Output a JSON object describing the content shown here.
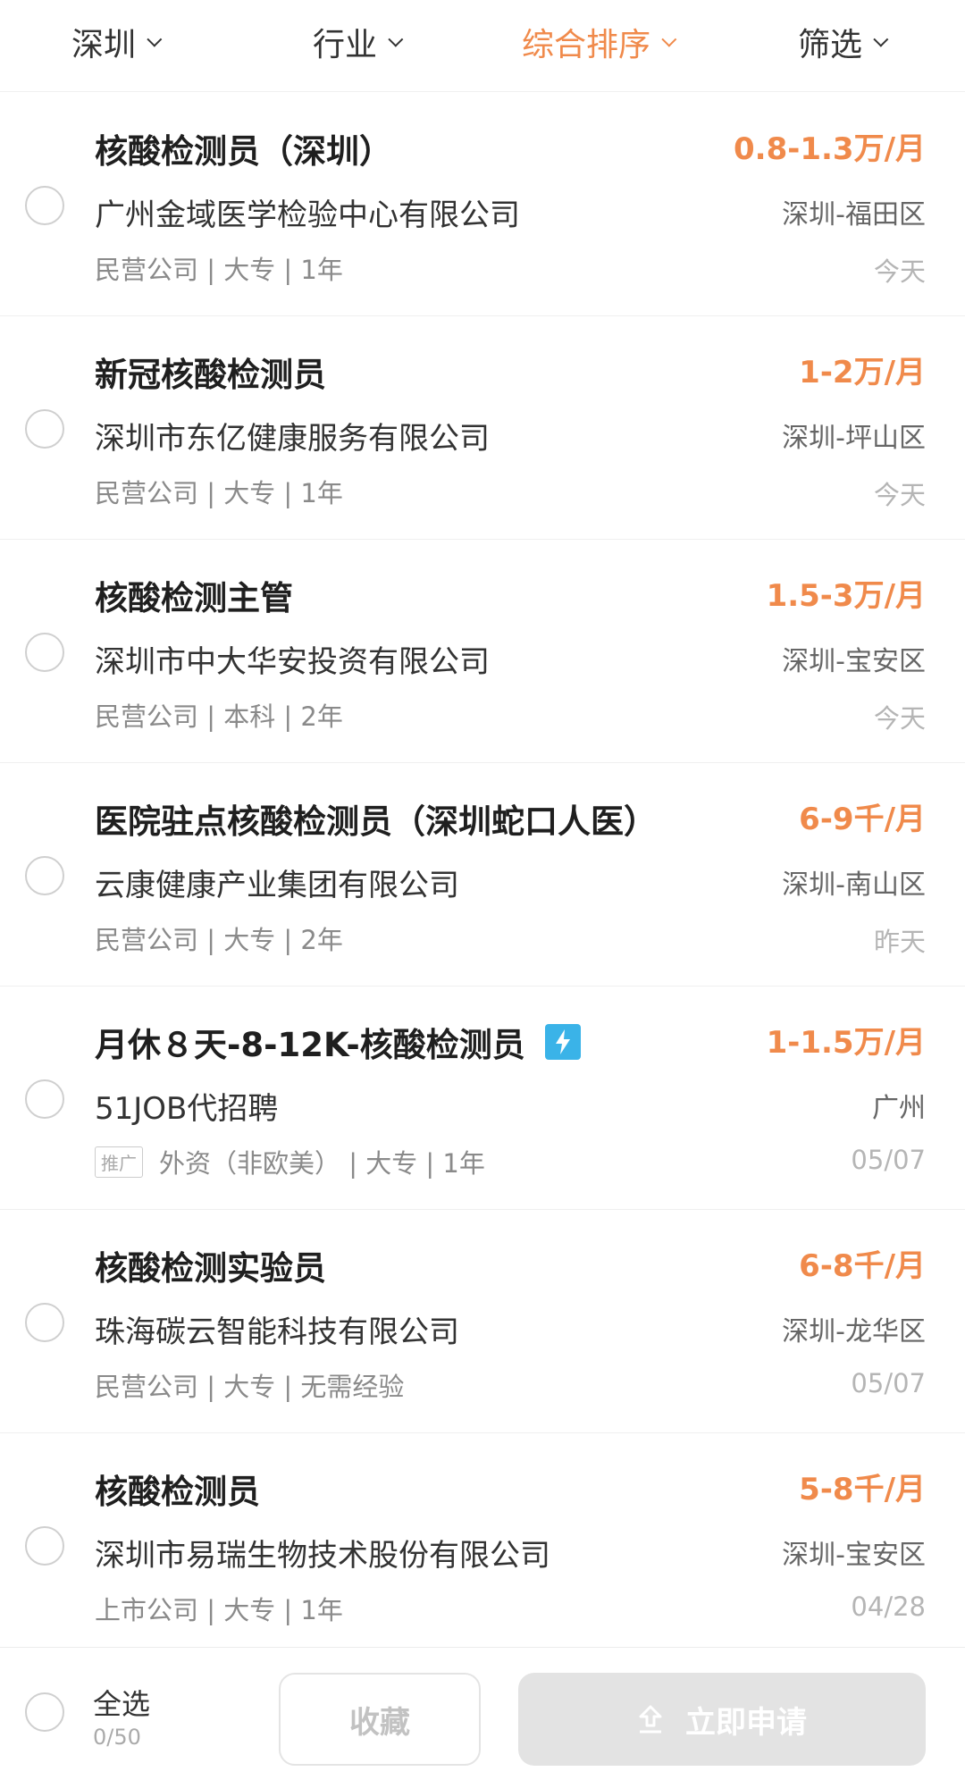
{
  "filters": [
    {
      "label": "深圳"
    },
    {
      "label": "行业"
    },
    {
      "label": "综合排序"
    },
    {
      "label": "筛选"
    }
  ],
  "accent_color": "#f08a4b",
  "jobs": [
    {
      "title": "核酸检测员（深圳）",
      "salary": "0.8-1.3万/月",
      "company": "广州金域医学检验中心有限公司",
      "location": "深圳-福田区",
      "meta": "民营公司 | 大专 | 1年",
      "date": "今天"
    },
    {
      "title": "新冠核酸检测员",
      "salary": "1-2万/月",
      "company": "深圳市东亿健康服务有限公司",
      "location": "深圳-坪山区",
      "meta": "民营公司 | 大专 | 1年",
      "date": "今天"
    },
    {
      "title": "核酸检测主管",
      "salary": "1.5-3万/月",
      "company": "深圳市中大华安投资有限公司",
      "location": "深圳-宝安区",
      "meta": "民营公司 | 本科 | 2年",
      "date": "今天"
    },
    {
      "title": "医院驻点核酸检测员（深圳蛇口人医）",
      "salary": "6-9千/月",
      "company": "云康健康产业集团有限公司",
      "location": "深圳-南山区",
      "meta": "民营公司 | 大专 | 2年",
      "date": "昨天"
    },
    {
      "title": "月休８天-8-12K-核酸检测员",
      "salary": "1-1.5万/月",
      "company": "51JOB代招聘",
      "location": "广州",
      "promo_tag": "推广",
      "meta": "外资（非欧美） | 大专 | 1年",
      "date": "05/07",
      "icon": "lightning-icon"
    },
    {
      "title": "核酸检测实验员",
      "salary": "6-8千/月",
      "company": "珠海碳云智能科技有限公司",
      "location": "深圳-龙华区",
      "meta": "民营公司 | 大专 | 无需经验",
      "date": "05/07"
    },
    {
      "title": "核酸检测员",
      "salary": "5-8千/月",
      "company": "深圳市易瑞生物技术股份有限公司",
      "location": "深圳-宝安区",
      "meta": "上市公司 | 大专 | 1年",
      "date": "04/28"
    }
  ],
  "bottom": {
    "select_all": "全选",
    "count": "0/50",
    "favorite": "收藏",
    "apply": "立即申请"
  }
}
